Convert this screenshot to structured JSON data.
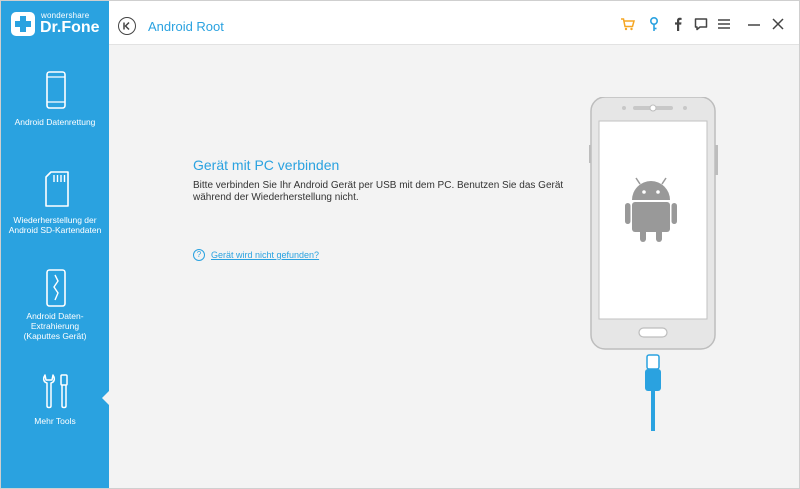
{
  "app": {
    "logo_top": "wondershare",
    "logo_main": "Dr.Fone",
    "title": "Android Root"
  },
  "toolbar": {
    "icons": [
      "cart-icon",
      "key-icon",
      "facebook-icon",
      "feedback-icon",
      "menu-icon",
      "minimize-icon",
      "close-icon"
    ],
    "accent_color": "#f5a623"
  },
  "sidebar": {
    "items": [
      {
        "label": "Android Datenrettung",
        "icon": "phone-icon"
      },
      {
        "label": "Wiederherstellung der Android SD-Kartendaten",
        "icon": "sd-card-icon"
      },
      {
        "label": "Android Daten-Extrahierung (Kaputtes Gerät)",
        "icon": "broken-phone-icon"
      },
      {
        "label": "Mehr Tools",
        "icon": "tools-icon"
      }
    ],
    "active_index": 3
  },
  "main": {
    "heading": "Gerät mit PC verbinden",
    "body": "Bitte verbinden Sie Ihr Android Gerät per USB mit dem PC. Benutzen Sie das Gerät während der Wiederherstellung nicht.",
    "help_icon": "?",
    "help_link": "Gerät wird nicht gefunden?"
  },
  "colors": {
    "brand": "#2aa2e0",
    "background": "#f3f3f3"
  }
}
